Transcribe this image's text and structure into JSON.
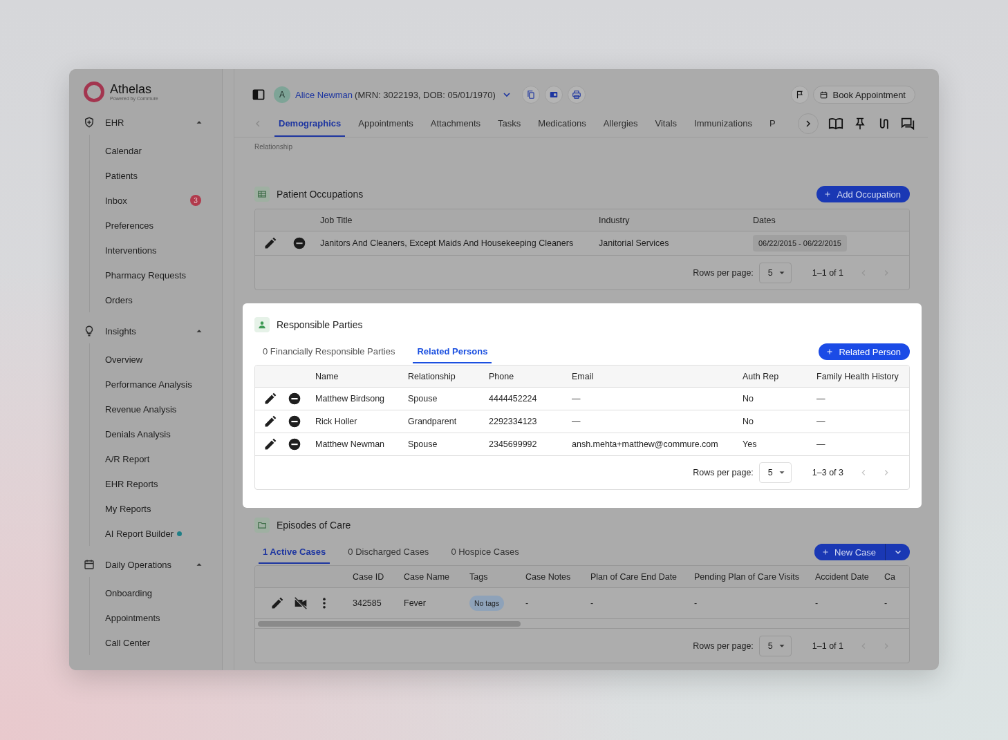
{
  "brand": {
    "name": "Athelas",
    "tagline": "Powered by Commure"
  },
  "sidebar": {
    "sections": [
      {
        "label": "EHR",
        "expanded": true,
        "items": [
          {
            "label": "Calendar"
          },
          {
            "label": "Patients"
          },
          {
            "label": "Inbox",
            "badge": "3"
          },
          {
            "label": "Preferences"
          },
          {
            "label": "Interventions"
          },
          {
            "label": "Pharmacy Requests"
          },
          {
            "label": "Orders"
          }
        ]
      },
      {
        "label": "Insights",
        "expanded": true,
        "items": [
          {
            "label": "Overview"
          },
          {
            "label": "Performance Analysis"
          },
          {
            "label": "Revenue Analysis"
          },
          {
            "label": "Denials Analysis"
          },
          {
            "label": "A/R Report"
          },
          {
            "label": "EHR Reports"
          },
          {
            "label": "My Reports"
          },
          {
            "label": "AI Report Builder",
            "new": true
          }
        ]
      },
      {
        "label": "Daily Operations",
        "expanded": true,
        "items": [
          {
            "label": "Onboarding"
          },
          {
            "label": "Appointments"
          },
          {
            "label": "Call Center"
          }
        ]
      }
    ]
  },
  "patient": {
    "avatar": "A",
    "name": "Alice Newman",
    "details": "(MRN: 3022193, DOB: 05/01/1970)",
    "book_button": "Book Appointment"
  },
  "tabs": [
    {
      "label": "Demographics",
      "selected": true
    },
    {
      "label": "Appointments",
      "selected": false
    },
    {
      "label": "Attachments",
      "selected": false
    },
    {
      "label": "Tasks",
      "selected": false
    },
    {
      "label": "Medications",
      "selected": false
    },
    {
      "label": "Allergies",
      "selected": false
    },
    {
      "label": "Vitals",
      "selected": false
    },
    {
      "label": "Immunizations",
      "selected": false
    },
    {
      "label": "P",
      "selected": false
    }
  ],
  "previous_section_label": "Relationship",
  "sections": [
    {
      "kind": "occupations",
      "title": "Patient Occupations",
      "highlighted": false,
      "button": "Add Occupation",
      "columns": [
        {
          "label": "Job Title",
          "kind": "text"
        },
        {
          "label": "Industry",
          "kind": "text"
        },
        {
          "label": "Dates",
          "kind": "chip"
        }
      ],
      "rows": [
        {
          "cells": [
            "Janitors And Cleaners, Except Maids And Housekeeping Cleaners",
            "Janitorial Services",
            "06/22/2015 - 06/22/2015"
          ]
        }
      ],
      "pagination": {
        "label": "Rows per page:",
        "rows_per_page": "5",
        "range": "1–1 of 1"
      }
    },
    {
      "kind": "parties",
      "title": "Responsible Parties",
      "highlighted": true,
      "button": "Related Person",
      "tabs": [
        {
          "label": "0 Financially Responsible Parties",
          "selected": false
        },
        {
          "label": "Related Persons",
          "selected": true
        }
      ],
      "columns": [
        {
          "label": "Name",
          "kind": "text"
        },
        {
          "label": "Relationship",
          "kind": "text"
        },
        {
          "label": "Phone",
          "kind": "text"
        },
        {
          "label": "Email",
          "kind": "text"
        },
        {
          "label": "Auth Rep",
          "kind": "text"
        },
        {
          "label": "Family Health History",
          "kind": "text"
        }
      ],
      "rows": [
        {
          "cells": [
            "Matthew Birdsong",
            "Spouse",
            "4444452224",
            "—",
            "No",
            "—"
          ]
        },
        {
          "cells": [
            "Rick Holler",
            "Grandparent",
            "2292334123",
            "—",
            "No",
            "—"
          ]
        },
        {
          "cells": [
            "Matthew Newman",
            "Spouse",
            "2345699992",
            "ansh.mehta+matthew@commure.com",
            "Yes",
            "—"
          ]
        }
      ],
      "pagination": {
        "label": "Rows per page:",
        "rows_per_page": "5",
        "range": "1–3 of 3"
      }
    },
    {
      "kind": "episodes",
      "title": "Episodes of Care",
      "highlighted": false,
      "button": "New Case",
      "tabs": [
        {
          "label": "1 Active Cases",
          "selected": true
        },
        {
          "label": "0 Discharged Cases",
          "selected": false
        },
        {
          "label": "0 Hospice Cases",
          "selected": false
        }
      ],
      "columns": [
        {
          "label": "Case ID",
          "kind": "text"
        },
        {
          "label": "Case Name",
          "kind": "text"
        },
        {
          "label": "Tags",
          "kind": "tag"
        },
        {
          "label": "Case Notes",
          "kind": "text"
        },
        {
          "label": "Plan of Care End Date",
          "kind": "text"
        },
        {
          "label": "Pending Plan of Care Visits",
          "kind": "text"
        },
        {
          "label": "Accident Date",
          "kind": "text"
        },
        {
          "label": "Ca",
          "kind": "text"
        }
      ],
      "rows": [
        {
          "cells": [
            "342585",
            "Fever",
            "No tags",
            "-",
            "-",
            "-",
            "-",
            "-"
          ]
        }
      ],
      "pagination": {
        "label": "Rows per page:",
        "rows_per_page": "5",
        "range": "1–1 of 1"
      }
    }
  ]
}
